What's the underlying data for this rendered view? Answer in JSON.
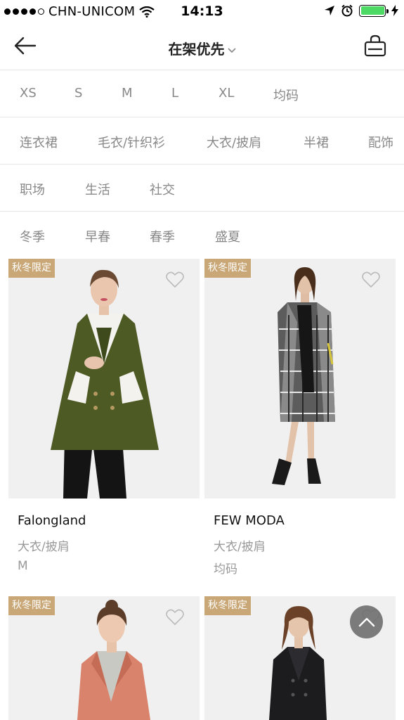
{
  "status": {
    "carrier": "CHN-UNICOM",
    "time": "14:13",
    "battery_level": 1.0
  },
  "nav": {
    "title": "在架优先",
    "back_icon": "arrow-left-icon",
    "cart_icon": "shopping-bag-icon"
  },
  "filters": {
    "sizes": [
      "XS",
      "S",
      "M",
      "L",
      "XL",
      "均码"
    ],
    "categories": [
      "连衣裙",
      "毛衣/针织衫",
      "大衣/披肩",
      "半裙",
      "配饰"
    ],
    "occasions": [
      "职场",
      "生活",
      "社交"
    ],
    "seasons": [
      "冬季",
      "早春",
      "春季",
      "盛夏"
    ]
  },
  "products": [
    {
      "tag": "秋冬限定",
      "brand": "Falongland",
      "category": "大衣/披肩",
      "size": "M"
    },
    {
      "tag": "秋冬限定",
      "brand": "FEW MODA",
      "category": "大衣/披肩",
      "size": "均码"
    },
    {
      "tag": "秋冬限定"
    },
    {
      "tag": "秋冬限定"
    }
  ],
  "colors": {
    "tag_bg": "#c9a777",
    "filter_text": "#888888",
    "divider": "#e6e6e6"
  }
}
